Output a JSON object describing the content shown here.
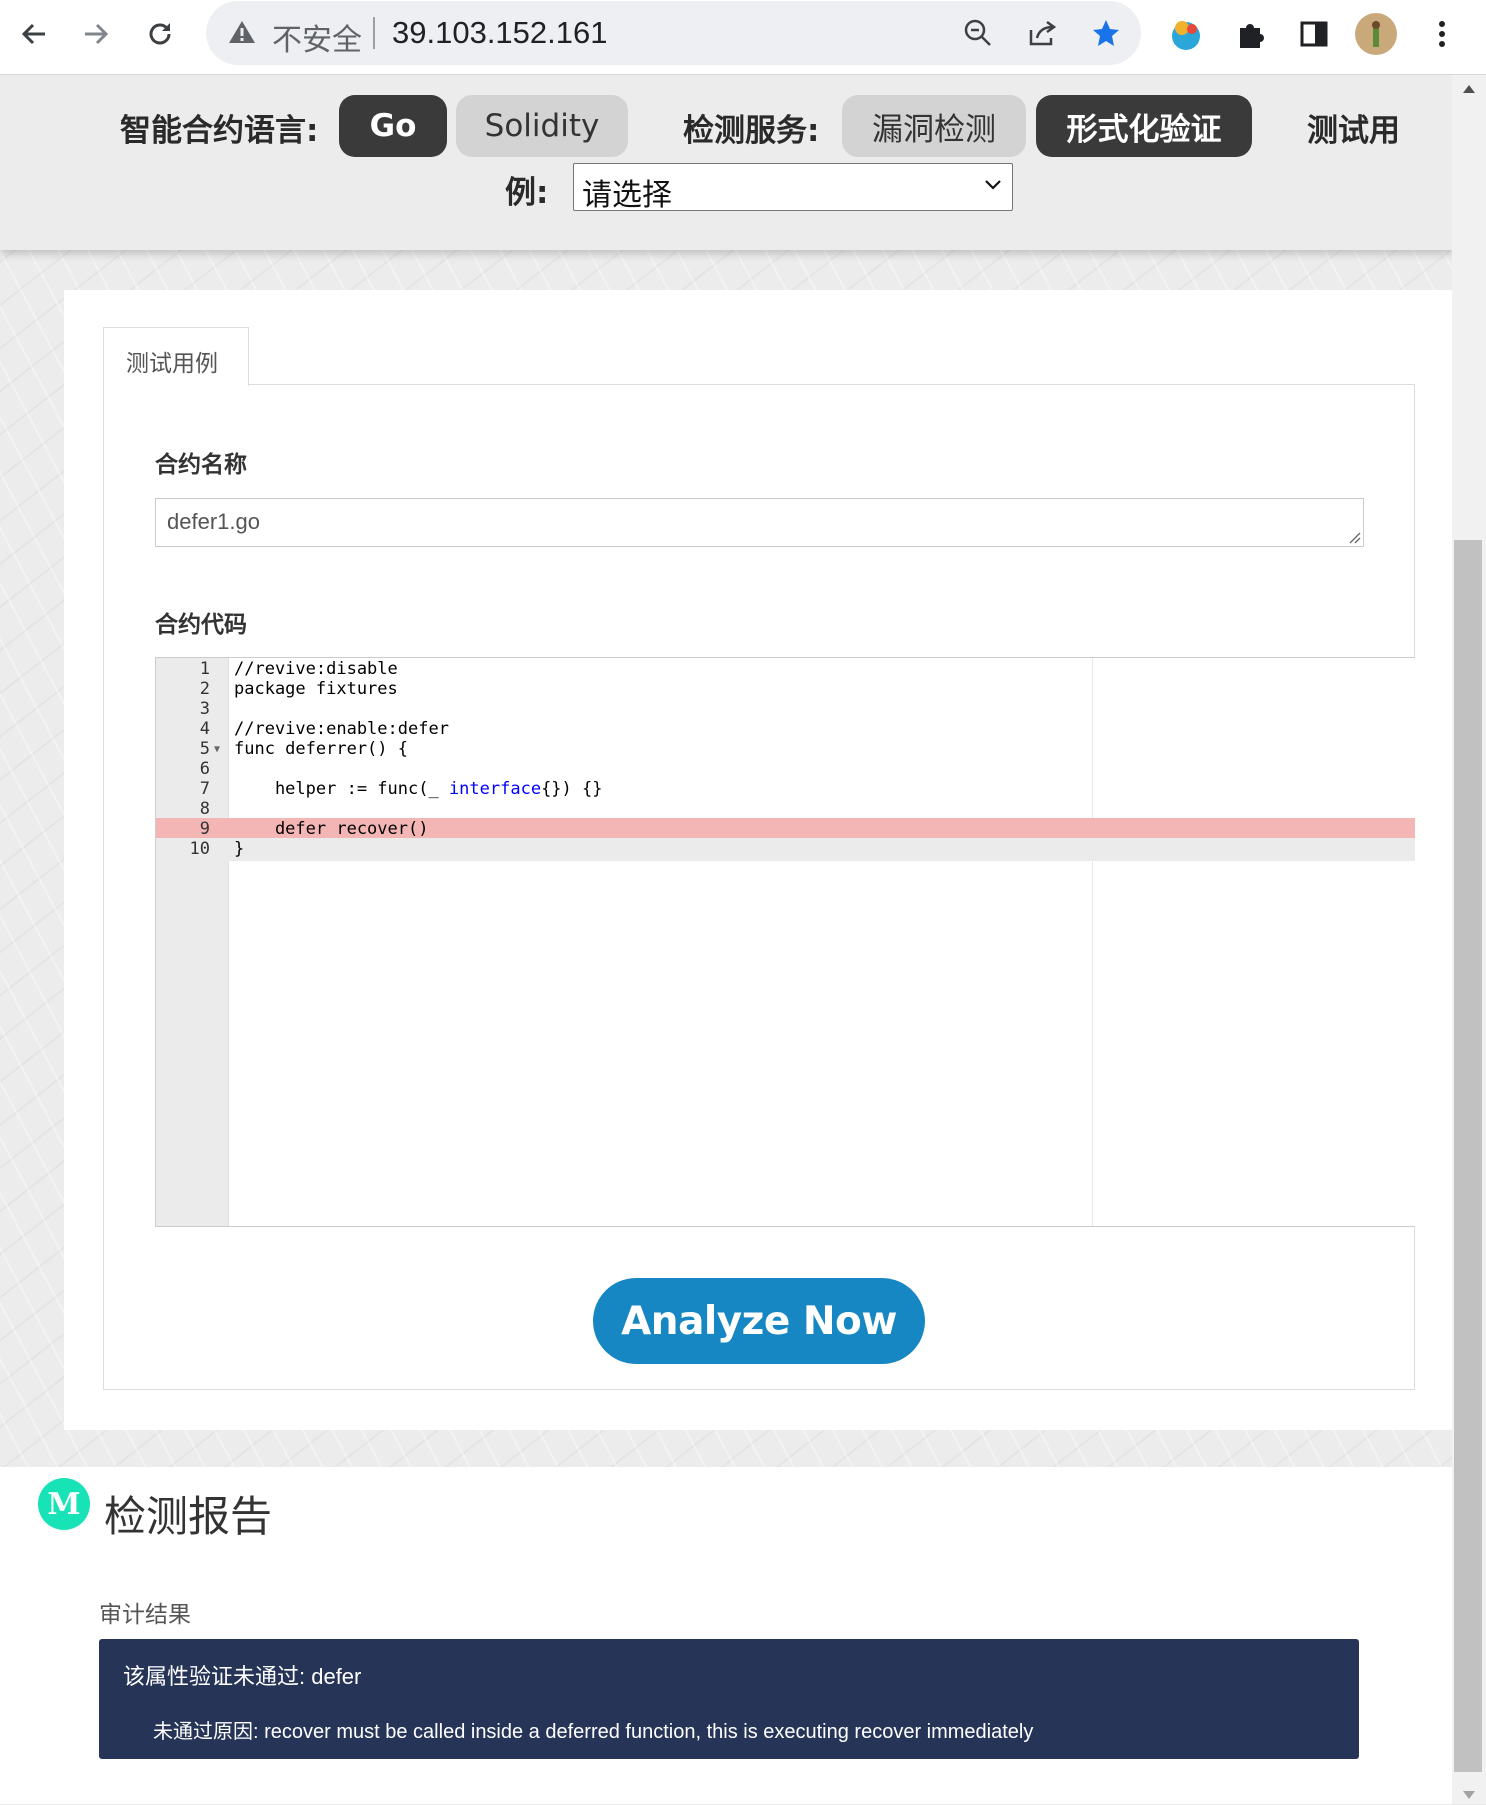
{
  "browser": {
    "security_text": "不安全",
    "url": "39.103.152.161"
  },
  "topbar": {
    "lang_label": "智能合约语言:",
    "lang_options": [
      "Go",
      "Solidity"
    ],
    "service_label": "检测服务:",
    "service_options": [
      "漏洞检测",
      "形式化验证"
    ],
    "example_label_part1": "测试用",
    "example_label_part2": "例:",
    "example_select_value": "请选择"
  },
  "tab": {
    "label": "测试用例"
  },
  "form": {
    "name_label": "合约名称",
    "name_value": "defer1.go",
    "code_label": "合约代码"
  },
  "code": {
    "line_numbers": [
      "1",
      "2",
      "3",
      "4",
      "5",
      "6",
      "7",
      "8",
      "9",
      "10"
    ],
    "lines": [
      "//revive:disable",
      "package fixtures",
      "",
      "//revive:enable:defer",
      "func deferrer() {",
      "",
      "    helper := func(_ interface{}) {}",
      "",
      "    defer recover()",
      "}"
    ],
    "error_line": 9,
    "active_line": 10
  },
  "actions": {
    "analyze_label": "Analyze Now"
  },
  "report": {
    "badge": "M",
    "title": "检测报告",
    "audit_label": "审计结果",
    "result_title": "该属性验证未通过: defer",
    "result_reason": "未通过原因: recover must be called inside a deferred function, this is executing recover immediately"
  },
  "colors": {
    "accent_button": "#1787c4",
    "dark_pill": "#3a3a3a",
    "result_bg": "#263457",
    "error_highlight": "#f4b6b4",
    "badge": "#17e3b6"
  }
}
